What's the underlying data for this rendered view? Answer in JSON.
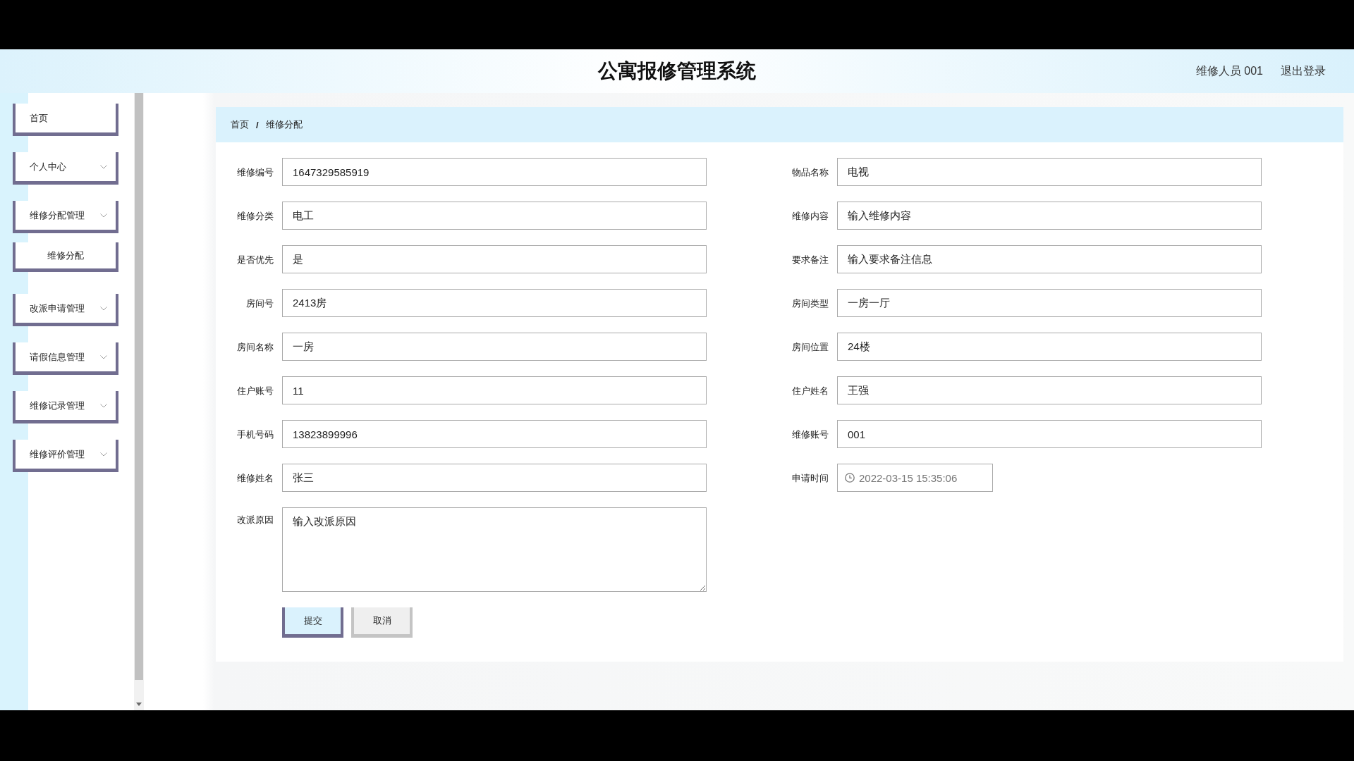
{
  "header": {
    "title": "公寓报修管理系统",
    "user": "维修人员 001",
    "logout": "退出登录"
  },
  "sidebar": {
    "items": [
      {
        "kind": "link",
        "label": "首页"
      },
      {
        "kind": "menu",
        "label": "个人中心"
      },
      {
        "kind": "menu",
        "label": "维修分配管理",
        "children": [
          {
            "label": "维修分配"
          }
        ]
      },
      {
        "kind": "menu",
        "label": "改派申请管理"
      },
      {
        "kind": "menu",
        "label": "请假信息管理"
      },
      {
        "kind": "menu",
        "label": "维修记录管理"
      },
      {
        "kind": "menu",
        "label": "维修评价管理"
      }
    ]
  },
  "breadcrumb": {
    "items": [
      "首页",
      "维修分配"
    ],
    "separator": "/"
  },
  "form": {
    "columns": [
      {
        "fields": [
          {
            "kind": "text",
            "label": "维修编号",
            "value": "1647329585919"
          },
          {
            "kind": "text",
            "label": "维修分类",
            "value": "电工"
          },
          {
            "kind": "text",
            "label": "是否优先",
            "value": "是"
          },
          {
            "kind": "text",
            "label": "房间号",
            "value": "2413房"
          },
          {
            "kind": "text",
            "label": "房间名称",
            "value": "一房"
          },
          {
            "kind": "text",
            "label": "住户账号",
            "value": "11"
          },
          {
            "kind": "text",
            "label": "手机号码",
            "value": "13823899996"
          },
          {
            "kind": "text",
            "label": "维修姓名",
            "value": "张三"
          },
          {
            "kind": "textarea",
            "label": "改派原因",
            "value": "输入改派原因"
          }
        ]
      },
      {
        "fields": [
          {
            "kind": "text",
            "label": "物品名称",
            "value": "电视"
          },
          {
            "kind": "text",
            "label": "维修内容",
            "value": "输入维修内容"
          },
          {
            "kind": "text",
            "label": "要求备注",
            "value": "输入要求备注信息"
          },
          {
            "kind": "text",
            "label": "房间类型",
            "value": "一房一厅"
          },
          {
            "kind": "text",
            "label": "房间位置",
            "value": "24楼"
          },
          {
            "kind": "text",
            "label": "住户姓名",
            "value": "王强"
          },
          {
            "kind": "text",
            "label": "维修账号",
            "value": "001"
          },
          {
            "kind": "date",
            "label": "申请时间",
            "value": "2022-03-15 15:35:06"
          }
        ]
      }
    ],
    "buttons": [
      {
        "kind": "primary",
        "label": "提交"
      },
      {
        "kind": "default",
        "label": "取消"
      }
    ]
  }
}
